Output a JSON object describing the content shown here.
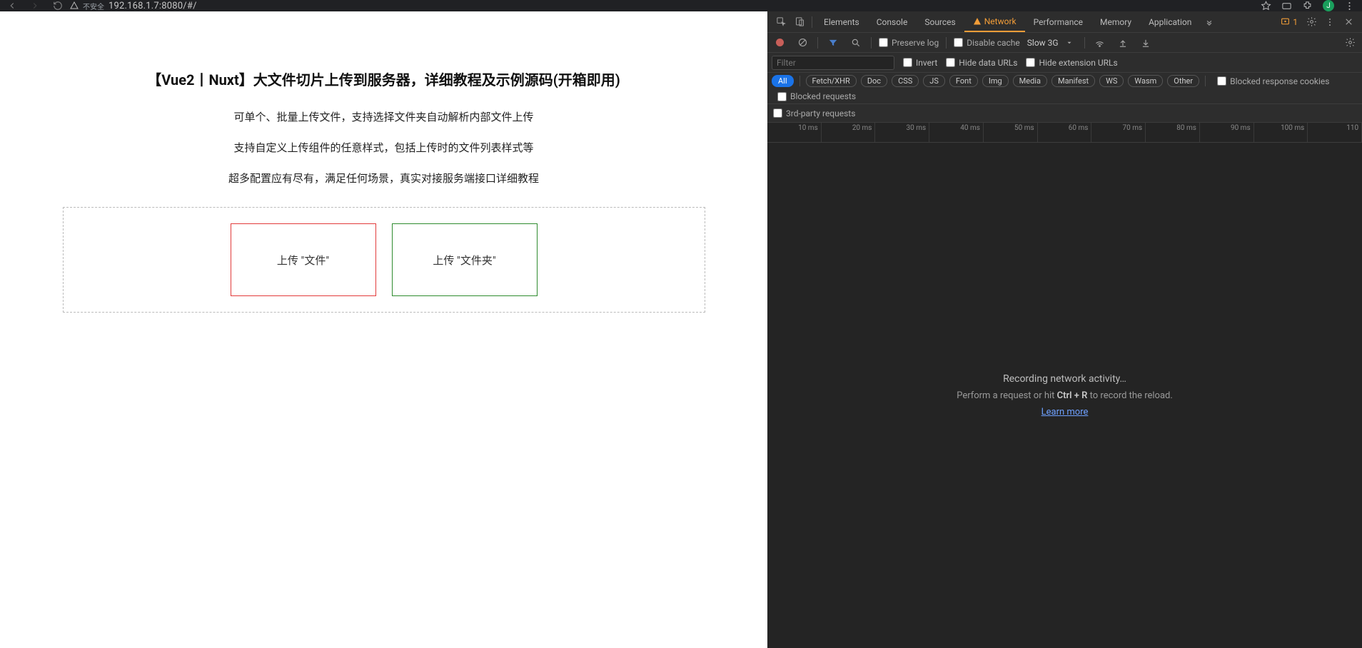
{
  "browser": {
    "url": "192.168.1.7:8080/#/",
    "insecure_label": "不安全",
    "avatar_letter": "J"
  },
  "page": {
    "title": "【Vue2丨Nuxt】大文件切片上传到服务器，详细教程及示例源码(开箱即用)",
    "line1": "可单个、批量上传文件，支持选择文件夹自动解析内部文件上传",
    "line2": "支持自定义上传组件的任意样式，包括上传时的文件列表样式等",
    "line3": "超多配置应有尽有，满足任何场景，真实对接服务端接口详细教程",
    "upload_file_label": "上传 \"文件\"",
    "upload_folder_label": "上传 \"文件夹\""
  },
  "devtools": {
    "tabs": {
      "elements": "Elements",
      "console": "Console",
      "sources": "Sources",
      "network": "Network",
      "performance": "Performance",
      "memory": "Memory",
      "application": "Application"
    },
    "issues_count": "1",
    "toolbar": {
      "preserve_log": "Preserve log",
      "disable_cache": "Disable cache",
      "throttling": "Slow 3G"
    },
    "filterbar": {
      "filter_placeholder": "Filter",
      "invert": "Invert",
      "hide_data_urls": "Hide data URLs",
      "hide_ext_urls": "Hide extension URLs"
    },
    "types": {
      "all": "All",
      "fetch": "Fetch/XHR",
      "doc": "Doc",
      "css": "CSS",
      "js": "JS",
      "font": "Font",
      "img": "Img",
      "media": "Media",
      "manifest": "Manifest",
      "ws": "WS",
      "wasm": "Wasm",
      "other": "Other",
      "blocked_cookies": "Blocked response cookies",
      "blocked_requests": "Blocked requests",
      "third_party": "3rd-party requests"
    },
    "timeline_ticks": [
      "10 ms",
      "20 ms",
      "30 ms",
      "40 ms",
      "50 ms",
      "60 ms",
      "70 ms",
      "80 ms",
      "90 ms",
      "100 ms",
      "110"
    ],
    "empty": {
      "recording": "Recording network activity…",
      "hint_pre": "Perform a request or hit ",
      "hint_key": "Ctrl + R",
      "hint_post": " to record the reload.",
      "learn_more": "Learn more"
    }
  }
}
